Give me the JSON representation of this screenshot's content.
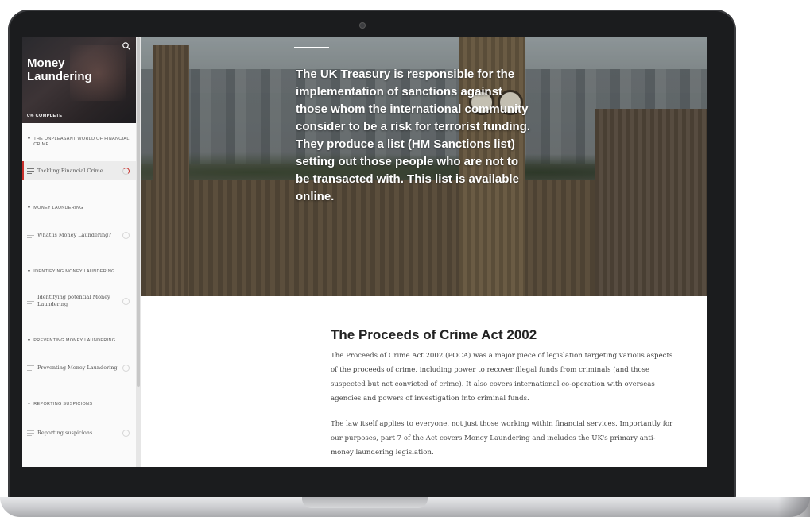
{
  "sidebar": {
    "course_title": "Money Laundering",
    "progress_text": "0% COMPLETE",
    "search_icon": "search-icon",
    "sections": [
      {
        "title": "THE UNPLEASANT WORLD OF FINANCIAL CRIME",
        "lessons": [
          {
            "label": "Tackling Financial Crime",
            "active": true
          }
        ]
      },
      {
        "title": "MONEY LAUNDERING",
        "lessons": [
          {
            "label": "What is Money Laundering?",
            "active": false
          }
        ]
      },
      {
        "title": "IDENTIFYING MONEY LAUNDERING",
        "lessons": [
          {
            "label": "Identifying potential Money Laundering",
            "active": false
          }
        ]
      },
      {
        "title": "PREVENTING MONEY LAUNDERING",
        "lessons": [
          {
            "label": "Preventing Money Laundering",
            "active": false
          }
        ]
      },
      {
        "title": "REPORTING SUSPICIONS",
        "lessons": [
          {
            "label": "Reporting suspicions",
            "active": false
          }
        ]
      }
    ]
  },
  "hero": {
    "text": "The UK Treasury is responsible for the implementation of sanctions against those whom the international community consider to be a risk for terrorist funding. They produce a list (HM Sanctions list) setting out those people who are not to be transacted with. This list is available online."
  },
  "article": {
    "title": "The Proceeds of Crime Act 2002",
    "paragraphs": [
      "The Proceeds of Crime Act 2002 (POCA) was a major piece of legislation targeting various aspects of the proceeds of crime, including power to recover illegal funds from criminals (and those suspected but not convicted of crime). It also covers international co-operation with overseas agencies and powers of investigation into criminal funds.",
      "The law itself applies to everyone, not just those working within financial services. Importantly for our purposes, part 7 of the Act covers Money Laundering and includes the UK's primary anti-money laundering legislation."
    ]
  },
  "colors": {
    "accent": "#c9302c",
    "sidebar_bg": "#fafafa",
    "device_frame": "#1b1c1e"
  }
}
